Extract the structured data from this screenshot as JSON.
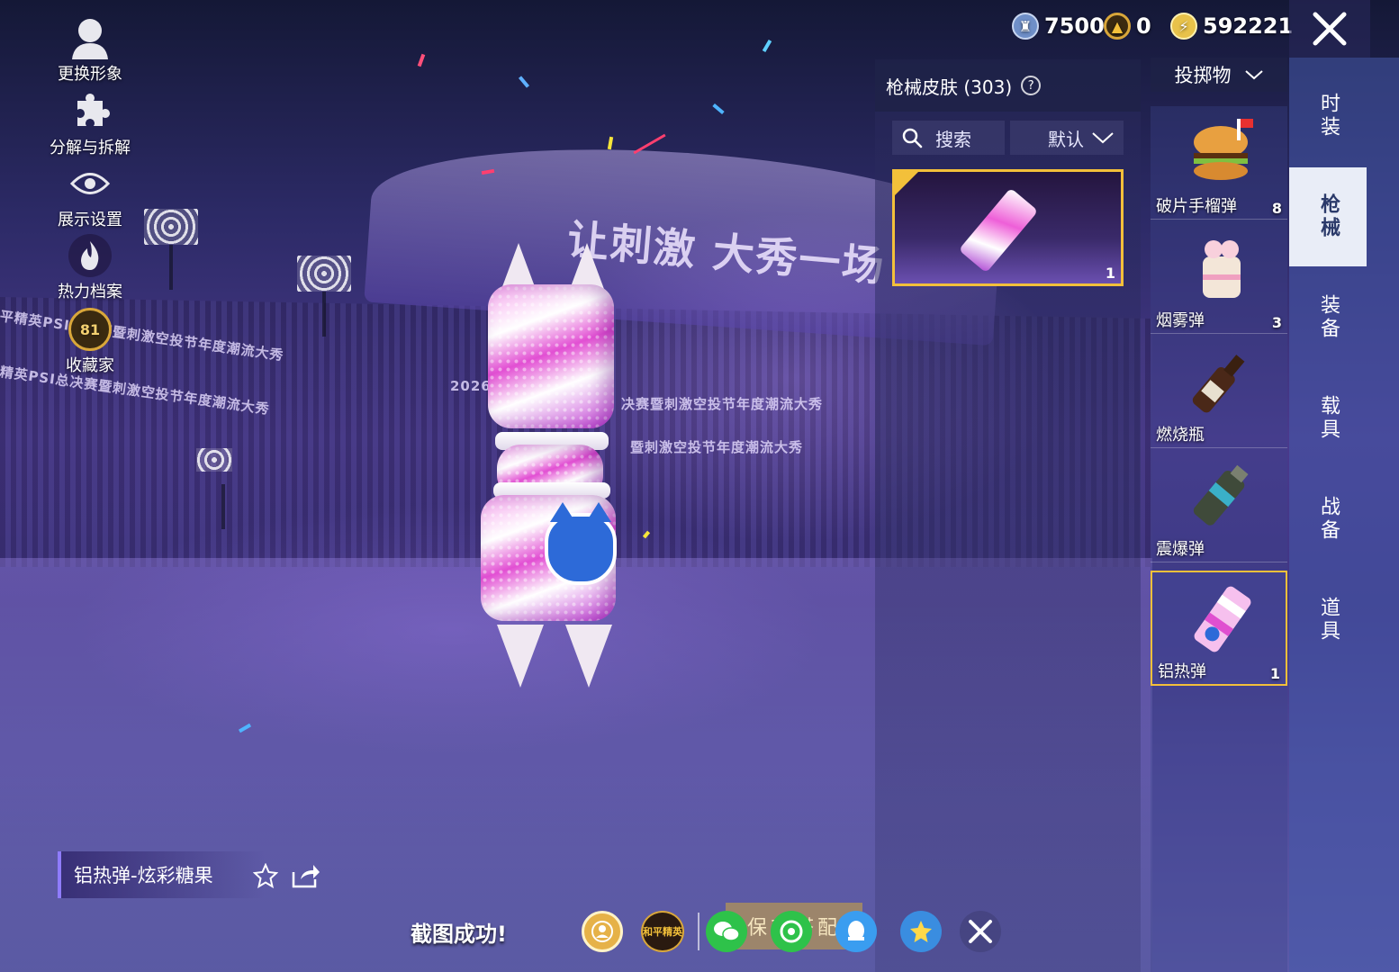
{
  "left_menu": [
    {
      "label": "更换形象",
      "icon": "person-icon"
    },
    {
      "label": "分解与拆解",
      "icon": "puzzle-icon"
    },
    {
      "label": "展示设置",
      "icon": "eye-icon"
    },
    {
      "label": "热力档案",
      "icon": "flame-icon"
    },
    {
      "label": "收藏家",
      "icon": "collector-badge-icon",
      "badge": "81"
    }
  ],
  "currency": [
    {
      "icon": "trophy-coin-icon",
      "value": "7500",
      "color": "#6f8fc8"
    },
    {
      "icon": "gold-token-icon",
      "value": "0",
      "color": "#d9a73a"
    },
    {
      "icon": "lightning-coin-icon",
      "value": "592221",
      "color": "#e8c24a"
    }
  ],
  "skin_panel": {
    "title": "枪械皮肤 (303)",
    "search_placeholder": "搜索",
    "sort_label": "默认",
    "selected_card_count": "1"
  },
  "category": {
    "selected": "投掷物"
  },
  "items": [
    {
      "name": "破片手榴弹",
      "count": "8",
      "icon": "burger-grenade-icon"
    },
    {
      "name": "烟雾弹",
      "count": "3",
      "icon": "bunny-cake-smoke-icon"
    },
    {
      "name": "燃烧瓶",
      "count": "",
      "icon": "molotov-bottle-icon"
    },
    {
      "name": "震爆弹",
      "count": "",
      "icon": "flashbang-icon"
    },
    {
      "name": "铝热弹",
      "count": "1",
      "icon": "candy-thermite-icon",
      "selected": true
    }
  ],
  "tabs": [
    {
      "label": "时装",
      "active": false
    },
    {
      "label": "枪械",
      "active": true
    },
    {
      "label": "装备",
      "active": false
    },
    {
      "label": "载具",
      "active": false
    },
    {
      "label": "战备",
      "active": false
    },
    {
      "label": "道具",
      "active": false
    }
  ],
  "scene": {
    "slogan": "让刺激   大秀一场",
    "banner_1": "平精英PSI总决赛暨刺激空投节年度潮流大秀",
    "banner_2": "精英PSI总决赛暨刺激空投节年度潮流大秀",
    "banner_3": "决赛暨刺激空投节年度潮流大秀",
    "banner_4": "暨刺激空投节年度潮流大秀",
    "year": "2026"
  },
  "item_display_name": "铝热弹-炫彩糖果",
  "share_bar": {
    "success_text": "截图成功!",
    "save_outfit_label": "保存搭配",
    "game_logo_text": "和平精英"
  },
  "colors": {
    "accent_gold": "#f3c03a",
    "tab_active_bg": "#e9edf7"
  }
}
